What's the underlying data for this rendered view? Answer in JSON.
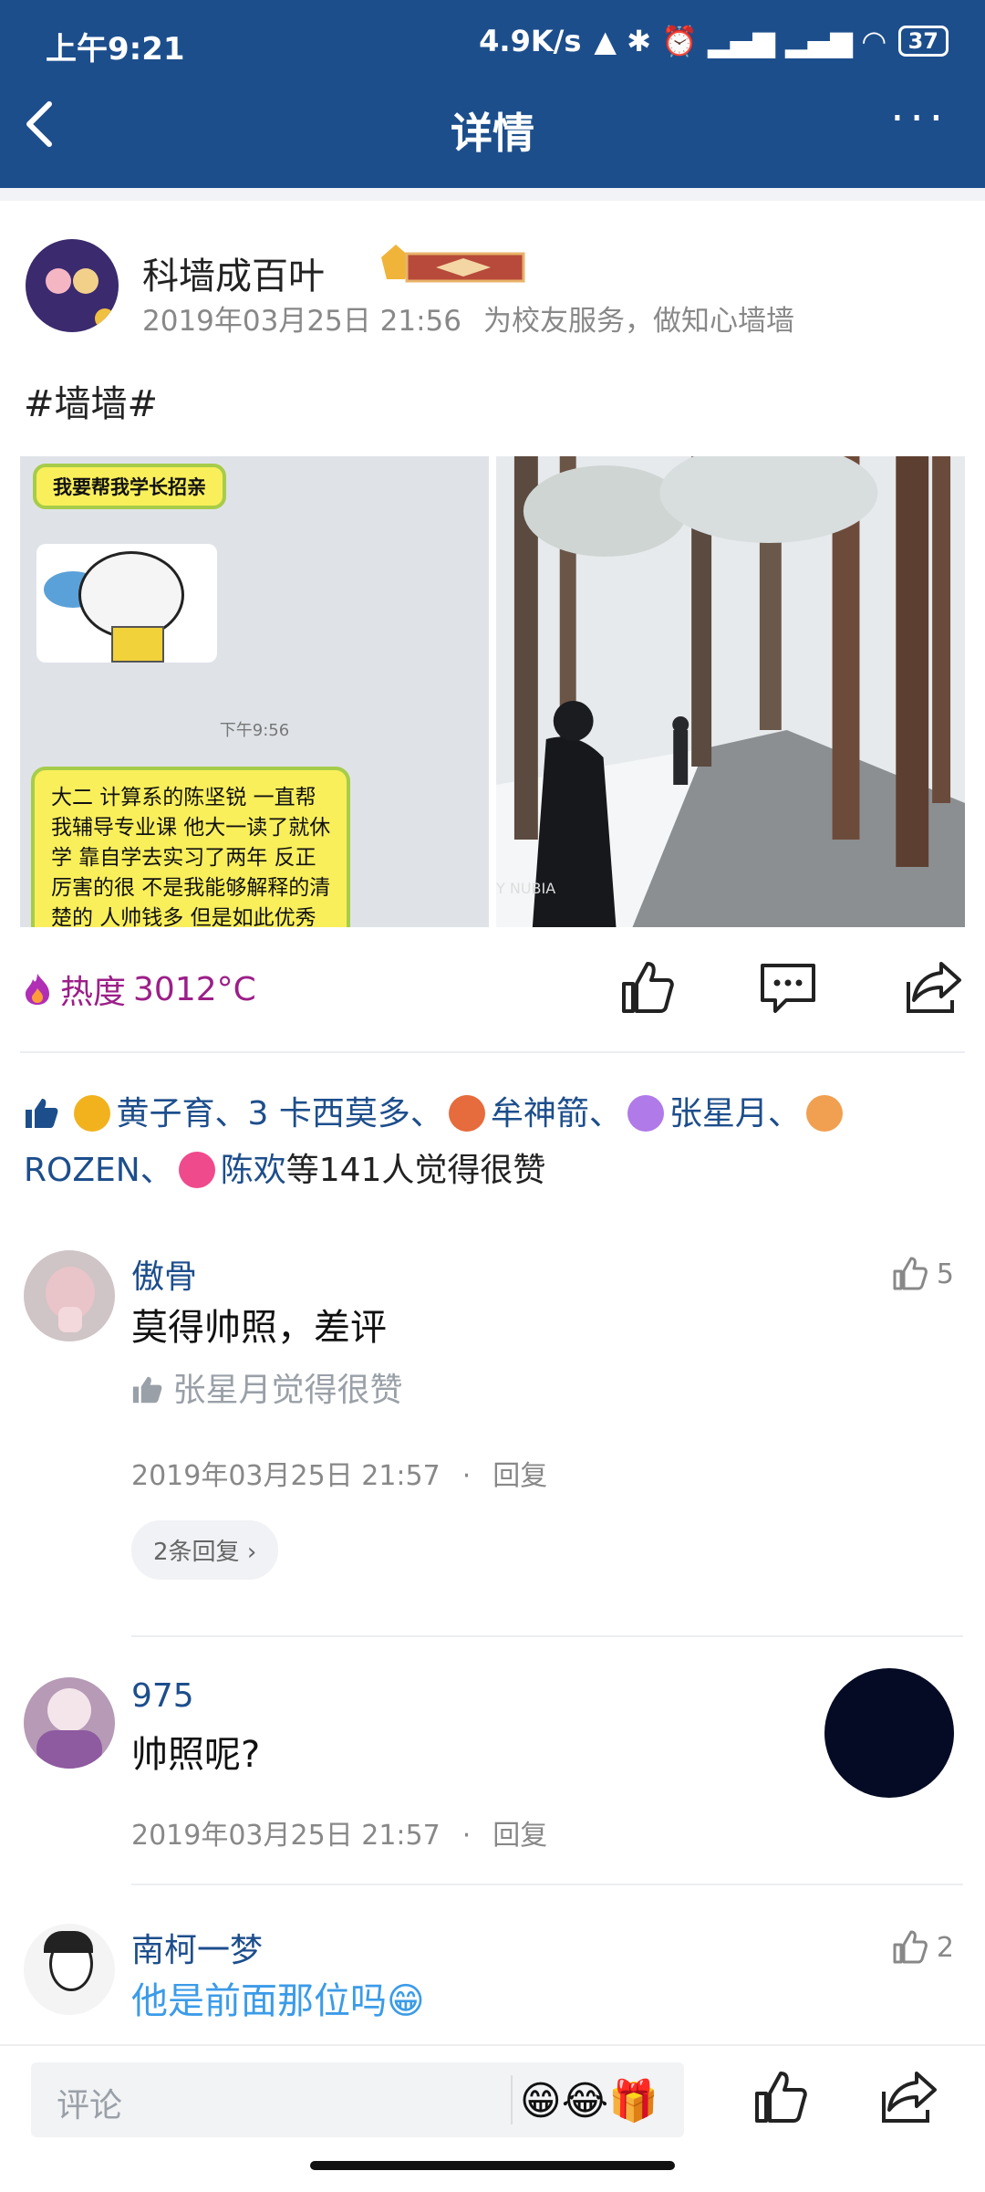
{
  "status": {
    "time": "上午9:21",
    "speed": "4.9K/s",
    "battery": "37"
  },
  "nav": {
    "title": "详情"
  },
  "post": {
    "author": "科墙成百叶",
    "time": "2019年03月25日 21:56",
    "signature": "为校友服务，做知心墙墙",
    "text": "#墙墙#",
    "image_left": {
      "top_bubble": "我要帮我学长招亲",
      "timestamp": "下午9:56",
      "bottom_bubble": "大二 计算系的陈坚锐 一直帮我辅导专业课 他大一读了就休学 靠自学去实习了两年 反正厉害的很 不是我能够解释的清楚的 人帅钱多 但是如此优秀的一个人"
    },
    "image_right": {
      "watermark": "Y NUBIA"
    },
    "heat_label": "热度",
    "heat_value": "3012°C"
  },
  "likes": {
    "names": [
      "黄子育、",
      "3 卡西莫多、",
      "牟神箭、",
      "张星月、",
      "ROZEN、",
      "陈欢"
    ],
    "suffix": "等141人觉得很赞"
  },
  "comments": [
    {
      "name": "傲骨",
      "text": "莫得帅照，差评",
      "liked_by": "张星月觉得很赞",
      "time": "2019年03月25日 21:57",
      "reply": "回复",
      "likes": "5",
      "replies": "2条回复"
    },
    {
      "name": "975",
      "text": "帅照呢?",
      "time": "2019年03月25日 21:57",
      "reply": "回复"
    },
    {
      "name": "南柯一梦",
      "text": "他是前面那位吗😁",
      "likes": "2"
    }
  ],
  "bottom": {
    "placeholder": "评论",
    "emojis": "😁😂🎁"
  },
  "colors": {
    "header": "#1d4e8c",
    "heat": "#9c1f88",
    "link": "#1d4e8c",
    "reply_blue": "#3b9be8"
  }
}
